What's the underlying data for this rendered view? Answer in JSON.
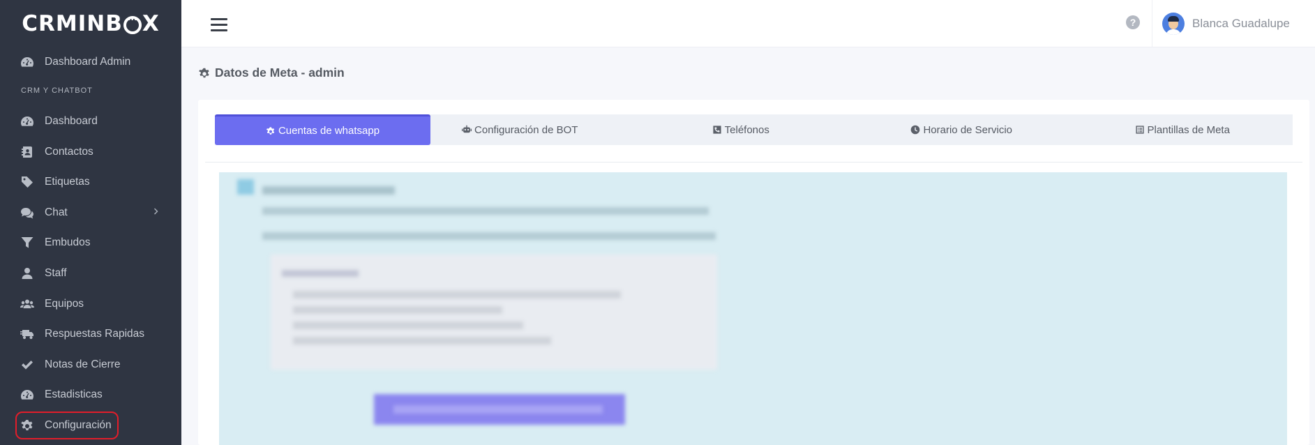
{
  "brand": {
    "logo_text_left": "CRMINB",
    "logo_text_right": "X"
  },
  "sidebar": {
    "section_label": "CRM Y CHATBOT",
    "items": [
      {
        "label": "Dashboard Admin",
        "icon": "dashboard-gauge-icon"
      },
      {
        "label": "Dashboard",
        "icon": "dashboard-gauge-icon"
      },
      {
        "label": "Contactos",
        "icon": "contact-card-icon"
      },
      {
        "label": "Etiquetas",
        "icon": "tag-icon"
      },
      {
        "label": "Chat",
        "icon": "comments-icon"
      },
      {
        "label": "Embudos",
        "icon": "funnel-icon"
      },
      {
        "label": "Staff",
        "icon": "user-icon"
      },
      {
        "label": "Equipos",
        "icon": "users-icon"
      },
      {
        "label": "Respuestas Rapidas",
        "icon": "truck-fast-icon"
      },
      {
        "label": "Notas de Cierre",
        "icon": "check-icon"
      },
      {
        "label": "Estadisticas",
        "icon": "dashboard-gauge-icon"
      },
      {
        "label": "Configuración",
        "icon": "gear-icon"
      }
    ]
  },
  "header": {
    "user_name": "Blanca Guadalupe",
    "help_symbol": "?"
  },
  "page": {
    "title": "Datos de Meta - admin"
  },
  "tabs": [
    {
      "label": "Cuentas de whatsapp",
      "icon": "gear-icon",
      "active": true
    },
    {
      "label": "Configuración de BOT",
      "icon": "robot-icon",
      "active": false
    },
    {
      "label": "Teléfonos",
      "icon": "phone-square-icon",
      "active": false
    },
    {
      "label": "Horario de Servicio",
      "icon": "clock-icon",
      "active": false
    },
    {
      "label": "Plantillas de Meta",
      "icon": "list-alt-icon",
      "active": false
    }
  ],
  "colors": {
    "sidebar_bg": "#2f3542",
    "accent": "#6c6df0",
    "highlight_border": "#e21d2a",
    "info_panel_bg": "#d9edf3"
  }
}
